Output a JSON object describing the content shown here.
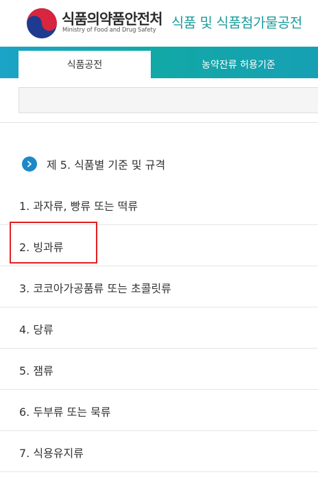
{
  "header": {
    "org_name_ko": "식품의약품안전처",
    "org_name_en": "Ministry of Food and Drug Safety",
    "site_title": "식품 및 식품첨가물공전"
  },
  "tabs": [
    {
      "label": "식품공전",
      "active": true
    },
    {
      "label": "농약잔류 허용기준",
      "active": false
    }
  ],
  "search": {
    "value": "",
    "placeholder": ""
  },
  "chapter": {
    "title": "제 5. 식품별 기준 및 규격"
  },
  "items": [
    {
      "label": "1. 과자류, 빵류 또는 떡류"
    },
    {
      "label": "2. 빙과류"
    },
    {
      "label": "3. 코코아가공품류 또는 초콜릿류"
    },
    {
      "label": "4. 당류"
    },
    {
      "label": "5. 잼류"
    },
    {
      "label": "6. 두부류 또는 묵류"
    },
    {
      "label": "7. 식용유지류"
    }
  ],
  "colors": {
    "accent": "#12a8a6",
    "title_teal": "#1d9c9c",
    "chapter_icon": "#1e88c8",
    "highlight": "#e01e1e"
  },
  "icons": {
    "logo": "taegeuk-logo",
    "chapter": "chevron-right-circle-icon"
  }
}
